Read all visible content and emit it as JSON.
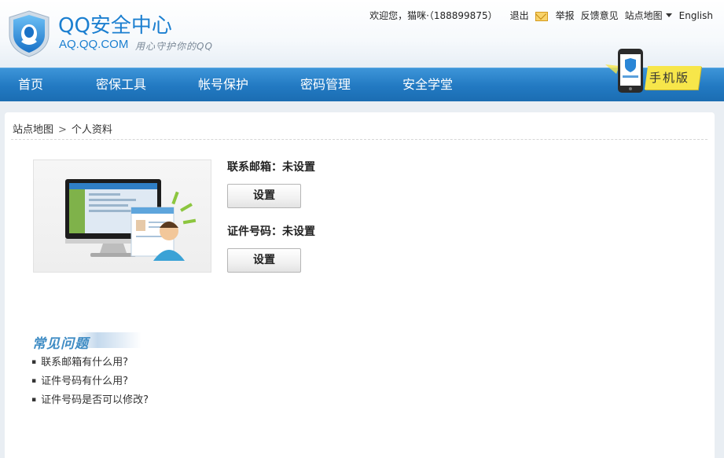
{
  "header": {
    "logo_title": "QQ安全中心",
    "logo_domain": "AQ.QQ.COM",
    "logo_slogan": "用心守护你的QQ",
    "welcome": "欢迎您，猫咪·（188899875）",
    "logout": "退出",
    "report": "举报",
    "feedback": "反馈意见",
    "sitemap": "站点地图",
    "language": "English"
  },
  "nav": {
    "items": [
      "首页",
      "密保工具",
      "帐号保护",
      "密码管理",
      "安全学堂"
    ],
    "mobile_label": "手机版"
  },
  "breadcrumb": {
    "root": "站点地图",
    "separator": ">",
    "current": "个人资料"
  },
  "profile": {
    "email_label": "联系邮箱：未设置",
    "email_button": "设置",
    "id_label": "证件号码：未设置",
    "id_button": "设置"
  },
  "faq": {
    "title": "常见问题",
    "items": [
      "联系邮箱有什么用?",
      "证件号码有什么用?",
      "证件号码是否可以修改?"
    ]
  },
  "colors": {
    "brand": "#1b7fd0",
    "nav_bg": "#2279c2",
    "accent_yellow": "#f7e64a"
  }
}
